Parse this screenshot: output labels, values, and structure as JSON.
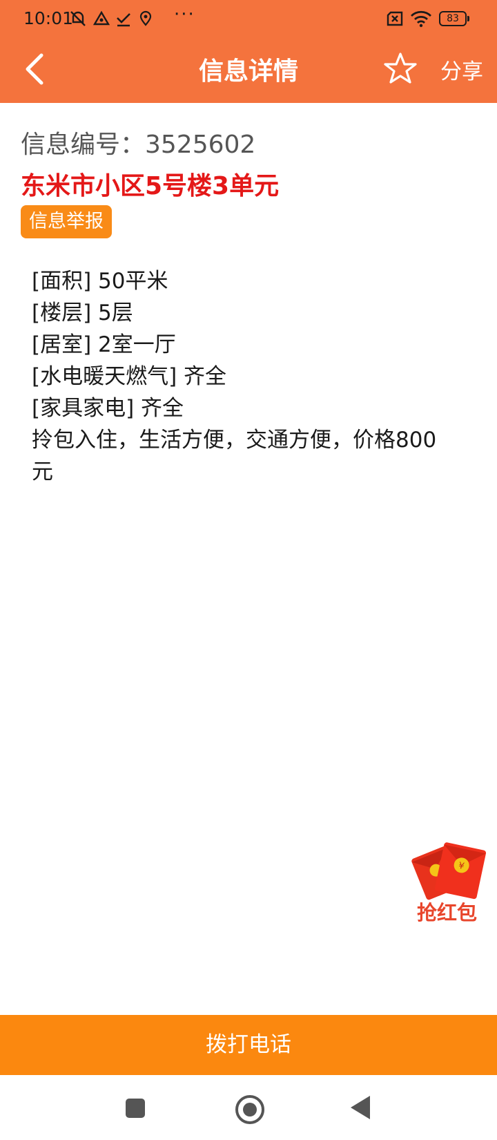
{
  "status_bar": {
    "time": "10:01",
    "more": "···",
    "battery": "83"
  },
  "header": {
    "title": "信息详情",
    "share_label": "分享",
    "back_icon": "chevron-left-icon",
    "favorite_icon": "star-outline-icon"
  },
  "listing": {
    "info_id": "信息编号：3525602",
    "title": "东米市小区5号楼3单元",
    "report_label": "信息举报",
    "details": [
      "[面积] 50平米",
      "[楼层] 5层",
      "[居室] 2室一厅",
      "[水电暖天燃气] 齐全",
      "[家具家电] 齐全",
      "拎包入住，生活方便，交通方便，价格800\n元"
    ]
  },
  "red_packet": {
    "label": "抢红包",
    "icon": "red-envelope-icon"
  },
  "bottom": {
    "call_label": "拨打电话"
  },
  "colors": {
    "header": "#f4733d",
    "title_red": "#e41818",
    "orange_button": "#fb880f"
  }
}
